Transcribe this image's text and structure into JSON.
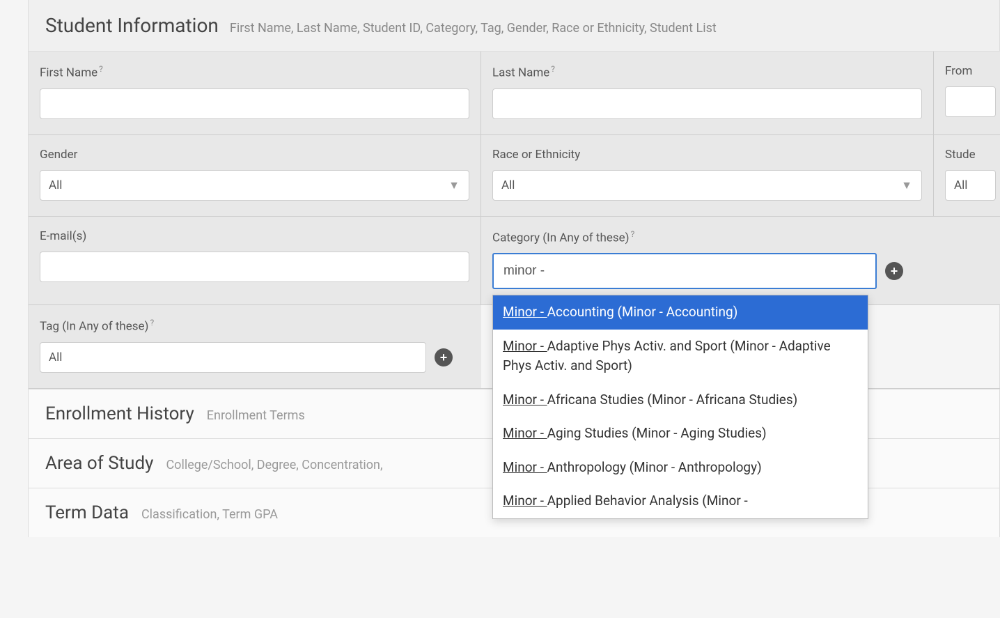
{
  "sections": {
    "student_info": {
      "title": "Student Information",
      "subtitle": "First Name, Last Name, Student ID, Category, Tag, Gender, Race or Ethnicity, Student List"
    },
    "enrollment_history": {
      "title": "Enrollment History",
      "subtitle": "Enrollment Terms"
    },
    "area_of_study": {
      "title": "Area of Study",
      "subtitle": "College/School, Degree, Concentration,"
    },
    "term_data": {
      "title": "Term Data",
      "subtitle": "Classification, Term GPA"
    }
  },
  "fields": {
    "first_name": {
      "label": "First Name",
      "value": "",
      "help": "?"
    },
    "last_name": {
      "label": "Last Name",
      "value": "",
      "help": "?"
    },
    "from": {
      "label": "From",
      "value": ""
    },
    "gender": {
      "label": "Gender",
      "value": "All"
    },
    "race": {
      "label": "Race or Ethnicity",
      "value": "All"
    },
    "student_list": {
      "label": "Stude",
      "value": "All"
    },
    "email": {
      "label": "E-mail(s)",
      "value": ""
    },
    "category": {
      "label": "Category (In Any of these)",
      "help": "?",
      "input_value": "minor -",
      "options": [
        {
          "prefix": "Minor - ",
          "rest": "Accounting (Minor - Accounting)",
          "selected": true
        },
        {
          "prefix": "Minor - ",
          "rest": "Adaptive Phys Activ. and Sport (Minor - Adaptive Phys Activ. and Sport)",
          "selected": false
        },
        {
          "prefix": "Minor - ",
          "rest": "Africana Studies (Minor - Africana Studies)",
          "selected": false
        },
        {
          "prefix": "Minor - ",
          "rest": "Aging Studies (Minor - Aging Studies)",
          "selected": false
        },
        {
          "prefix": "Minor - ",
          "rest": "Anthropology (Minor - Anthropology)",
          "selected": false
        },
        {
          "prefix": "Minor - ",
          "rest": "Applied Behavior Analysis (Minor -",
          "selected": false
        }
      ]
    },
    "tag": {
      "label": "Tag (In Any of these)",
      "help": "?",
      "value": "All"
    }
  },
  "icons": {
    "add": "+"
  }
}
